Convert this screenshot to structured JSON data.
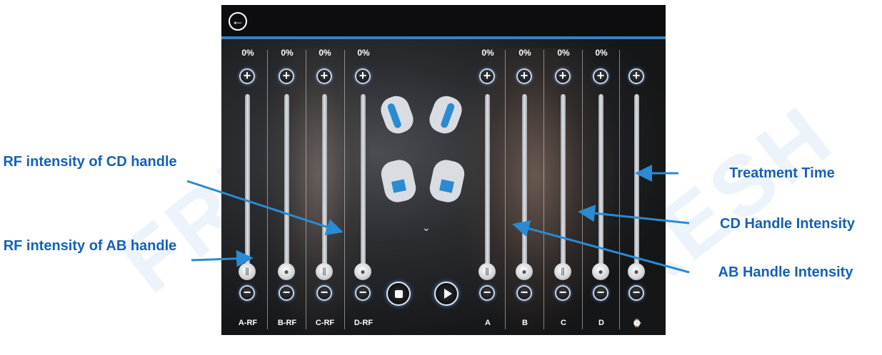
{
  "watermark": "FRESH",
  "screen": {
    "back_icon": "back-arrow-icon",
    "columns": [
      {
        "id": "a-rf",
        "percent": "0%",
        "label": "A-RF",
        "thumb_icon": "sliders-icon"
      },
      {
        "id": "b-rf",
        "percent": "0%",
        "label": "B-RF",
        "thumb_icon": "handle-icon"
      },
      {
        "id": "c-rf",
        "percent": "0%",
        "label": "C-RF",
        "thumb_icon": "sliders-icon"
      },
      {
        "id": "d-rf",
        "percent": "0%",
        "label": "D-RF",
        "thumb_icon": "handle-icon"
      },
      {
        "id": "a",
        "percent": "0%",
        "label": "A",
        "thumb_icon": "sliders-icon"
      },
      {
        "id": "b",
        "percent": "0%",
        "label": "B",
        "thumb_icon": "handle-icon"
      },
      {
        "id": "c",
        "percent": "0%",
        "label": "C",
        "thumb_icon": "sliders-icon"
      },
      {
        "id": "d",
        "percent": "0%",
        "label": "D",
        "thumb_icon": "handle-icon"
      },
      {
        "id": "time",
        "percent": "",
        "label": "⌚",
        "thumb_icon": "handle-icon"
      }
    ],
    "stop_icon": "stop-icon",
    "play_icon": "play-icon",
    "chevron_icon": "chevron-down-icon",
    "accent_color": "#3d7fc0"
  },
  "callouts": {
    "rf_cd": "RF intensity of CD handle",
    "rf_ab": "RF intensity of AB handle",
    "treatment_time": "Treatment Time",
    "cd_intensity": "CD Handle Intensity",
    "ab_intensity": "AB Handle Intensity",
    "color": "#1560b8"
  }
}
